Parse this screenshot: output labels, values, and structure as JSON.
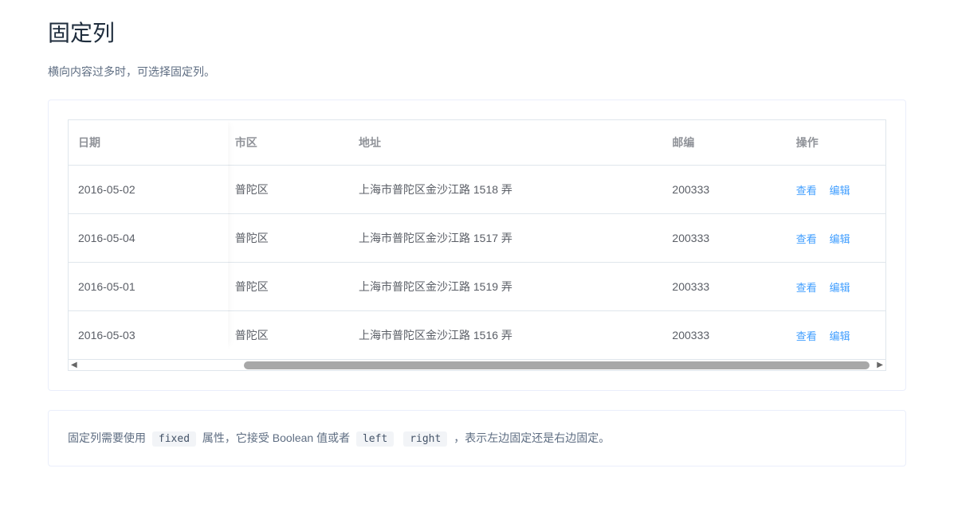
{
  "heading": "固定列",
  "description": "横向内容过多时，可选择固定列。",
  "table": {
    "headers": {
      "date": "日期",
      "district": "市区",
      "address": "地址",
      "zip": "邮编",
      "action": "操作"
    },
    "rows": [
      {
        "date": "2016-05-02",
        "district": "普陀区",
        "address": "上海市普陀区金沙江路 1518 弄",
        "zip": "200333"
      },
      {
        "date": "2016-05-04",
        "district": "普陀区",
        "address": "上海市普陀区金沙江路 1517 弄",
        "zip": "200333"
      },
      {
        "date": "2016-05-01",
        "district": "普陀区",
        "address": "上海市普陀区金沙江路 1519 弄",
        "zip": "200333"
      },
      {
        "date": "2016-05-03",
        "district": "普陀区",
        "address": "上海市普陀区金沙江路 1516 弄",
        "zip": "200333"
      }
    ],
    "actions": {
      "view": "查看",
      "edit": "编辑"
    }
  },
  "note": {
    "pre": "固定列需要使用",
    "code1": "fixed",
    "mid": "属性，它接受 Boolean 值或者",
    "code2": "left",
    "code3": "right",
    "post": "，表示左边固定还是右边固定。"
  }
}
